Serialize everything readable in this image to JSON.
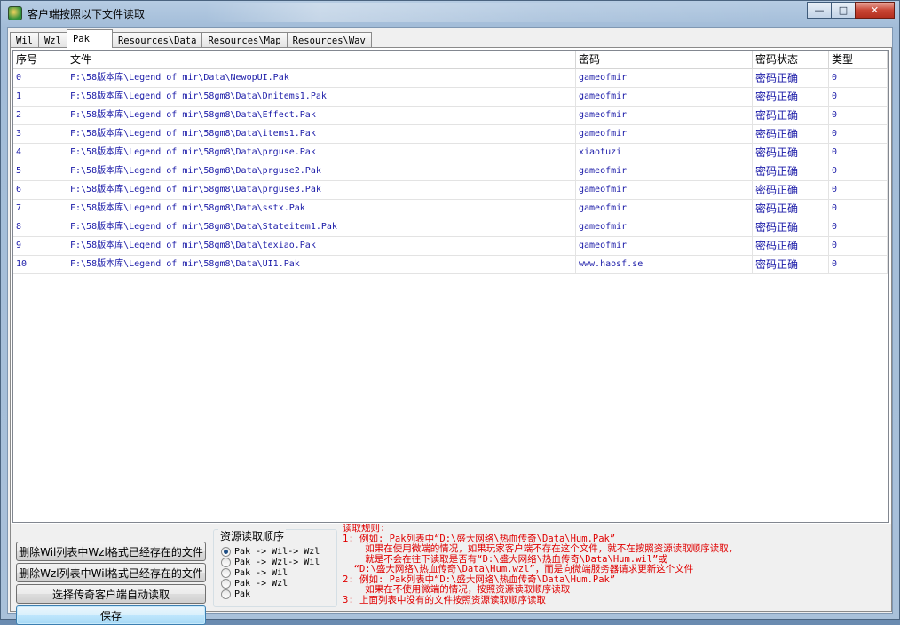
{
  "window": {
    "title": "客户端按照以下文件读取",
    "minimize_glyph": "—",
    "maximize_glyph": "□",
    "close_glyph": "✕"
  },
  "tabs": [
    {
      "label": "Wil",
      "active": false
    },
    {
      "label": "Wzl",
      "active": false
    },
    {
      "label": "Pak",
      "active": true
    },
    {
      "label": "Resources\\Data",
      "active": false
    },
    {
      "label": "Resources\\Map",
      "active": false
    },
    {
      "label": "Resources\\Wav",
      "active": false
    }
  ],
  "table": {
    "columns": [
      "序号",
      "文件",
      "密码",
      "密码状态",
      "类型"
    ],
    "rows": [
      [
        "0",
        "F:\\58版本库\\Legend of mir\\Data\\NewopUI.Pak",
        "gameofmir",
        "密码正确",
        "0"
      ],
      [
        "1",
        "F:\\58版本库\\Legend of mir\\58gm8\\Data\\Dnitems1.Pak",
        "gameofmir",
        "密码正确",
        "0"
      ],
      [
        "2",
        "F:\\58版本库\\Legend of mir\\58gm8\\Data\\Effect.Pak",
        "gameofmir",
        "密码正确",
        "0"
      ],
      [
        "3",
        "F:\\58版本库\\Legend of mir\\58gm8\\Data\\items1.Pak",
        "gameofmir",
        "密码正确",
        "0"
      ],
      [
        "4",
        "F:\\58版本库\\Legend of mir\\58gm8\\Data\\prguse.Pak",
        "xiaotuzi",
        "密码正确",
        "0"
      ],
      [
        "5",
        "F:\\58版本库\\Legend of mir\\58gm8\\Data\\prguse2.Pak",
        "gameofmir",
        "密码正确",
        "0"
      ],
      [
        "6",
        "F:\\58版本库\\Legend of mir\\58gm8\\Data\\prguse3.Pak",
        "gameofmir",
        "密码正确",
        "0"
      ],
      [
        "7",
        "F:\\58版本库\\Legend of mir\\58gm8\\Data\\sstx.Pak",
        "gameofmir",
        "密码正确",
        "0"
      ],
      [
        "8",
        "F:\\58版本库\\Legend of mir\\58gm8\\Data\\Stateitem1.Pak",
        "gameofmir",
        "密码正确",
        "0"
      ],
      [
        "9",
        "F:\\58版本库\\Legend of mir\\58gm8\\Data\\texiao.Pak",
        "gameofmir",
        "密码正确",
        "0"
      ],
      [
        "10",
        "F:\\58版本库\\Legend of mir\\58gm8\\Data\\UI1.Pak",
        "www.haosf.se",
        "密码正确",
        "0"
      ]
    ]
  },
  "buttons": {
    "delete_wil": "删除Wil列表中Wzl格式已经存在的文件",
    "delete_wzl": "删除Wzl列表中Wil格式已经存在的文件",
    "auto_read": "选择传奇客户端自动读取",
    "save": "保存"
  },
  "resource_order": {
    "title": "资源读取顺序",
    "options": [
      {
        "label": "Pak -> Wil-> Wzl",
        "selected": true
      },
      {
        "label": "Pak -> Wzl-> Wil",
        "selected": false
      },
      {
        "label": "Pak -> Wil",
        "selected": false
      },
      {
        "label": "Pak -> Wzl",
        "selected": false
      },
      {
        "label": "Pak",
        "selected": false
      }
    ]
  },
  "rules": {
    "lines": [
      "读取规则:",
      "1: 例如: Pak列表中“D:\\盛大网络\\热血传奇\\Data\\Hum.Pak”",
      "    如果在使用微端的情况，如果玩家客户端不存在这个文件，就不在按照资源读取顺序读取，",
      "    就是不会在往下读取是否有“D:\\盛大网络\\热血传奇\\Data\\Hum.wil”或",
      "  “D:\\盛大网络\\热血传奇\\Data\\Hum.wzl”，而是向微端服务器请求更新这个文件",
      "2: 例如: Pak列表中“D:\\盛大网络\\热血传奇\\Data\\Hum.Pak”",
      "    如果在不使用微端的情况，按照资源读取顺序读取",
      "3: 上面列表中没有的文件按照资源读取顺序读取"
    ],
    "color": "#e00000"
  },
  "colors": {
    "row_text": "#1b1ba8",
    "rules_text": "#e00000"
  }
}
